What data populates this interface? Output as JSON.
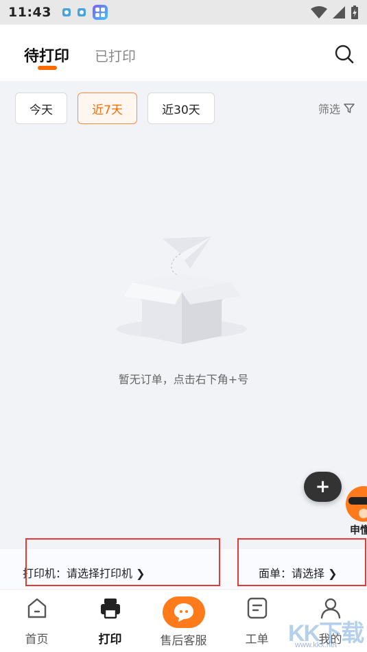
{
  "status_bar": {
    "time": "11:43"
  },
  "header": {
    "tabs": [
      {
        "label": "待打印"
      },
      {
        "label": "已打印"
      }
    ]
  },
  "filters": {
    "chips": [
      {
        "label": "今天"
      },
      {
        "label": "近7天"
      },
      {
        "label": "近30天"
      }
    ],
    "filter_label": "筛选"
  },
  "empty_state": {
    "message": "暂无订单，点击右下角+号"
  },
  "fab": {
    "label": "+"
  },
  "mascot": {
    "label": "申懂"
  },
  "printer_bar": {
    "printer": "打印机：请选择打印机 ❯",
    "waybill": "面单：请选择 ❯"
  },
  "bottom_nav": {
    "items": [
      {
        "label": "首页"
      },
      {
        "label": "打印"
      },
      {
        "label": "售后客服"
      },
      {
        "label": "工单"
      },
      {
        "label": "我的"
      }
    ]
  },
  "watermark": {
    "text": "KK下载",
    "url": "www.kkx.net"
  },
  "colors": {
    "accent": "#ff6a00",
    "highlight_box": "#e53935"
  }
}
